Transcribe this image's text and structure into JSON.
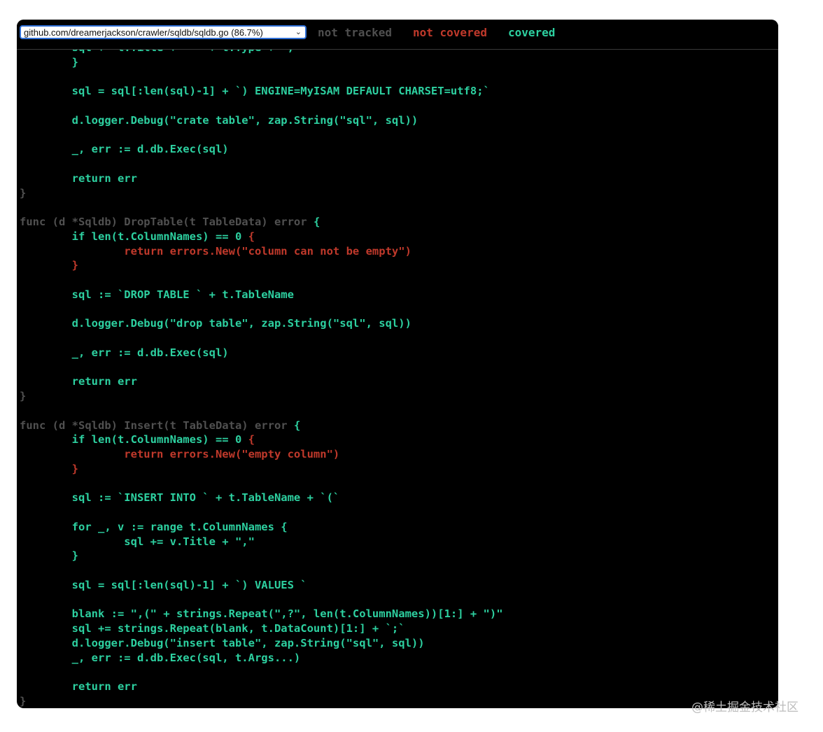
{
  "toolbar": {
    "file_select_value": "github.com/dreamerjackson/crawler/sqldb/sqldb.go (86.7%)",
    "legend_not_tracked": "not tracked",
    "legend_not_covered": "not covered",
    "legend_covered": "covered"
  },
  "colors": {
    "covered": "#2dd0a0",
    "not_covered": "#c0392b",
    "not_tracked": "#505050",
    "background": "#000000"
  },
  "code": {
    "lines": [
      [
        {
          "t": "        sql += t.Title + \" \" + t.Type + \",\"",
          "c": "cov"
        }
      ],
      [
        {
          "t": "        }",
          "c": "cov"
        }
      ],
      [
        {
          "t": "",
          "c": "cov"
        }
      ],
      [
        {
          "t": "        sql = sql[:len(sql)-1] + `) ENGINE=MyISAM DEFAULT CHARSET=utf8;`",
          "c": "cov"
        }
      ],
      [
        {
          "t": "",
          "c": "cov"
        }
      ],
      [
        {
          "t": "        d.logger.Debug(\"crate table\", zap.String(\"sql\", sql))",
          "c": "cov"
        }
      ],
      [
        {
          "t": "",
          "c": "cov"
        }
      ],
      [
        {
          "t": "        _, err := d.db.Exec(sql)",
          "c": "cov"
        }
      ],
      [
        {
          "t": "",
          "c": "cov"
        }
      ],
      [
        {
          "t": "        return err",
          "c": "cov"
        }
      ],
      [
        {
          "t": "}",
          "c": "nt"
        }
      ],
      [
        {
          "t": "",
          "c": "cov"
        }
      ],
      [
        {
          "t": "func (d *Sqldb) DropTable(t TableData) error ",
          "c": "nt"
        },
        {
          "t": "{",
          "c": "cov"
        }
      ],
      [
        {
          "t": "        if len(t.ColumnNames) == 0 ",
          "c": "cov"
        },
        {
          "t": "{",
          "c": "unc"
        }
      ],
      [
        {
          "t": "                return errors.New(\"column can not be empty\")",
          "c": "unc"
        }
      ],
      [
        {
          "t": "        }",
          "c": "unc"
        }
      ],
      [
        {
          "t": "",
          "c": "cov"
        }
      ],
      [
        {
          "t": "        sql := `DROP TABLE ` + t.TableName",
          "c": "cov"
        }
      ],
      [
        {
          "t": "",
          "c": "cov"
        }
      ],
      [
        {
          "t": "        d.logger.Debug(\"drop table\", zap.String(\"sql\", sql))",
          "c": "cov"
        }
      ],
      [
        {
          "t": "",
          "c": "cov"
        }
      ],
      [
        {
          "t": "        _, err := d.db.Exec(sql)",
          "c": "cov"
        }
      ],
      [
        {
          "t": "",
          "c": "cov"
        }
      ],
      [
        {
          "t": "        return err",
          "c": "cov"
        }
      ],
      [
        {
          "t": "}",
          "c": "nt"
        }
      ],
      [
        {
          "t": "",
          "c": "cov"
        }
      ],
      [
        {
          "t": "func (d *Sqldb) Insert(t TableData) error ",
          "c": "nt"
        },
        {
          "t": "{",
          "c": "cov"
        }
      ],
      [
        {
          "t": "        if len(t.ColumnNames) == 0 ",
          "c": "cov"
        },
        {
          "t": "{",
          "c": "unc"
        }
      ],
      [
        {
          "t": "                return errors.New(\"empty column\")",
          "c": "unc"
        }
      ],
      [
        {
          "t": "        }",
          "c": "unc"
        }
      ],
      [
        {
          "t": "",
          "c": "cov"
        }
      ],
      [
        {
          "t": "        sql := `INSERT INTO ` + t.TableName + `(`",
          "c": "cov"
        }
      ],
      [
        {
          "t": "",
          "c": "cov"
        }
      ],
      [
        {
          "t": "        for _, v := range t.ColumnNames {",
          "c": "cov"
        }
      ],
      [
        {
          "t": "                sql += v.Title + \",\"",
          "c": "cov"
        }
      ],
      [
        {
          "t": "        }",
          "c": "cov"
        }
      ],
      [
        {
          "t": "",
          "c": "cov"
        }
      ],
      [
        {
          "t": "        sql = sql[:len(sql)-1] + `) VALUES `",
          "c": "cov"
        }
      ],
      [
        {
          "t": "",
          "c": "cov"
        }
      ],
      [
        {
          "t": "        blank := \",(\" + strings.Repeat(\",?\", len(t.ColumnNames))[1:] + \")\"",
          "c": "cov"
        }
      ],
      [
        {
          "t": "        sql += strings.Repeat(blank, t.DataCount)[1:] + `;`",
          "c": "cov"
        }
      ],
      [
        {
          "t": "        d.logger.Debug(\"insert table\", zap.String(\"sql\", sql))",
          "c": "cov"
        }
      ],
      [
        {
          "t": "        _, err := d.db.Exec(sql, t.Args...)",
          "c": "cov"
        }
      ],
      [
        {
          "t": "",
          "c": "cov"
        }
      ],
      [
        {
          "t": "        return err",
          "c": "cov"
        }
      ],
      [
        {
          "t": "}",
          "c": "nt"
        }
      ]
    ]
  },
  "watermark": "@稀土掘金技术社区"
}
